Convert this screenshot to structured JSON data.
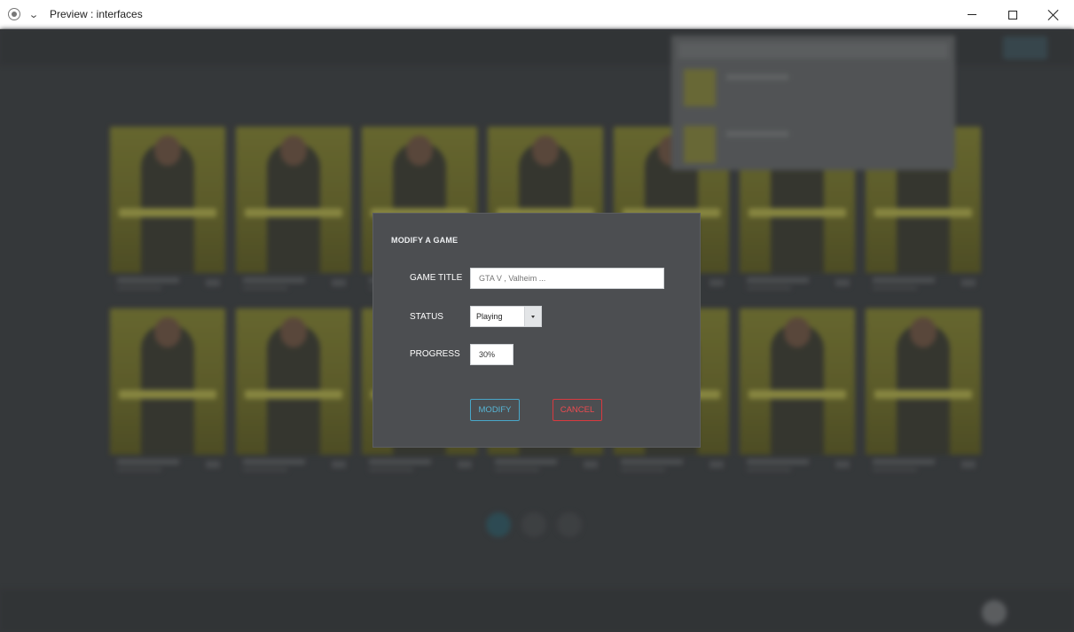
{
  "window": {
    "title": "Preview : interfaces"
  },
  "modal": {
    "title": "MODIFY A GAME",
    "fields": {
      "game_title_label": "GAME TITLE",
      "game_title_placeholder": "GTA V , Valheim ...",
      "status_label": "STATUS",
      "status_value": "Playing",
      "progress_label": "PROGRESS",
      "progress_value": "30%"
    },
    "buttons": {
      "modify": "MODIFY",
      "cancel": "CANCEL"
    }
  },
  "colors": {
    "modify_accent": "#57b6d6",
    "cancel_accent": "#ec4b50",
    "modal_bg": "#4c4e51",
    "backdrop": "#3a3c3f"
  },
  "icons": {
    "app": "record-icon",
    "menu": "chevron-down-icon",
    "minimize": "minimize-icon",
    "maximize": "maximize-icon",
    "close": "close-icon",
    "status_dropdown": "caret-down-icon"
  }
}
